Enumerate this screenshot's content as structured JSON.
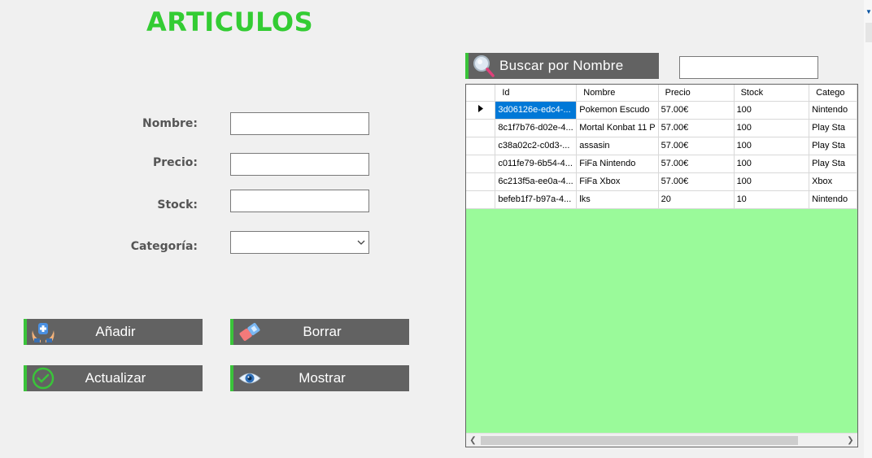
{
  "title": "ARTICULOS",
  "form": {
    "nombre_label": "Nombre:",
    "precio_label": "Precio:",
    "stock_label": "Stock:",
    "categoria_label": "Categoría:",
    "nombre_value": "",
    "precio_value": "",
    "stock_value": "",
    "categoria_value": ""
  },
  "buttons": {
    "add": "Añadir",
    "delete": "Borrar",
    "update": "Actualizar",
    "show": "Mostrar"
  },
  "search": {
    "button_label": "Buscar por Nombre",
    "input_value": ""
  },
  "grid": {
    "columns": [
      "Id",
      "Nombre",
      "Precio",
      "Stock",
      "Catego"
    ],
    "rows": [
      [
        "3d06126e-edc4-...",
        "Pokemon Escudo",
        "57.00€",
        "100",
        "Nintendo"
      ],
      [
        "8c1f7b76-d02e-4...",
        "Mortal Konbat 11 P",
        "57.00€",
        "100",
        "Play Sta"
      ],
      [
        "c38a02c2-c0d3-...",
        "assasin",
        "57.00€",
        "100",
        "Play Sta"
      ],
      [
        "c011fe79-6b54-4...",
        "FiFa Nintendo",
        "57.00€",
        "100",
        "Play Sta"
      ],
      [
        "6c213f5a-ee0a-4...",
        "FiFa Xbox",
        "57.00€",
        "100",
        "Xbox"
      ],
      [
        "befeb1f7-b97a-4...",
        "lks",
        "20",
        "10",
        "Nintendo"
      ]
    ],
    "selected_row": 0
  },
  "colors": {
    "accent_green": "#33cc33",
    "grid_background": "#9afa9a",
    "button_bg": "#626262"
  }
}
